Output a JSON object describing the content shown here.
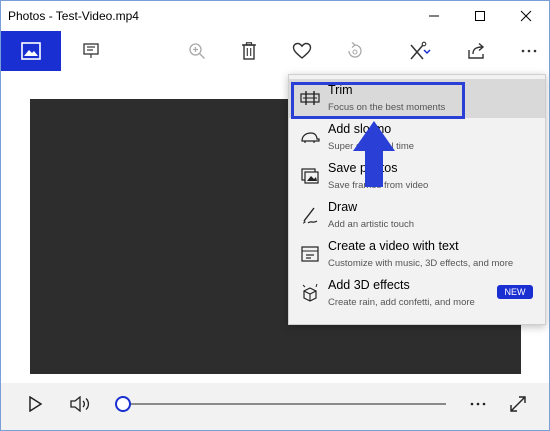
{
  "window": {
    "title": "Photos - Test-Video.mp4"
  },
  "toolbar": {
    "items": [
      "home-icon",
      "slideshow-icon",
      "zoom-icon",
      "delete-icon",
      "favorite-icon",
      "rotate-icon",
      "edit-create-icon",
      "share-icon",
      "more-icon"
    ]
  },
  "menu": {
    "items": [
      {
        "title": "Trim",
        "subtitle": "Focus on the best moments",
        "icon": "trim-icon"
      },
      {
        "title": "Add slo-mo",
        "subtitle": "Super slow real time",
        "icon": "slo-mo-icon"
      },
      {
        "title": "Save photos",
        "subtitle": "Save frames from video",
        "icon": "save-photos-icon"
      },
      {
        "title": "Draw",
        "subtitle": "Add an artistic touch",
        "icon": "draw-icon"
      },
      {
        "title": "Create a video with text",
        "subtitle": "Customize with music, 3D effects, and more",
        "icon": "video-text-icon"
      },
      {
        "title": "Add 3D effects",
        "subtitle": "Create rain, add confetti, and more",
        "icon": "3d-effects-icon",
        "badge": "NEW"
      }
    ]
  },
  "playback": {
    "progress": 0.0
  },
  "colors": {
    "accent": "#1a2fd1",
    "video_bg": "#2d2d2d",
    "menu_bg": "#f2f2f2"
  }
}
